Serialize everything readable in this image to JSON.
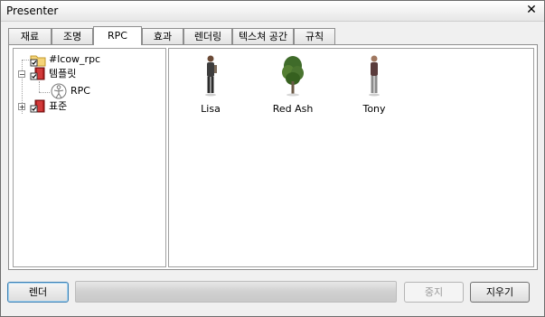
{
  "window": {
    "title": "Presenter",
    "close_glyph": "✕"
  },
  "tabs": [
    {
      "label": "재료",
      "active": false
    },
    {
      "label": "조명",
      "active": false
    },
    {
      "label": "RPC",
      "active": true
    },
    {
      "label": "효과",
      "active": false
    },
    {
      "label": "렌더링",
      "active": false
    },
    {
      "label": "텍스쳐 공간",
      "active": false
    },
    {
      "label": "규칙",
      "active": false
    }
  ],
  "tree": {
    "items": [
      {
        "label": "#lcow_rpc",
        "icon": "folder-icon",
        "expander": ""
      },
      {
        "label": "템플릿",
        "icon": "book-icon",
        "expander": "−"
      },
      {
        "label": "RPC",
        "icon": "figure-icon",
        "expander": ""
      },
      {
        "label": "표준",
        "icon": "book-icon",
        "expander": "+"
      }
    ]
  },
  "content": {
    "items": [
      {
        "label": "Lisa",
        "icon": "person-icon"
      },
      {
        "label": "Red Ash",
        "icon": "tree-icon"
      },
      {
        "label": "Tony",
        "icon": "person-icon"
      }
    ]
  },
  "buttons": {
    "render_label": "렌더",
    "stop_label": "중지",
    "clear_label": "지우기"
  },
  "progress": {
    "value": 0
  }
}
